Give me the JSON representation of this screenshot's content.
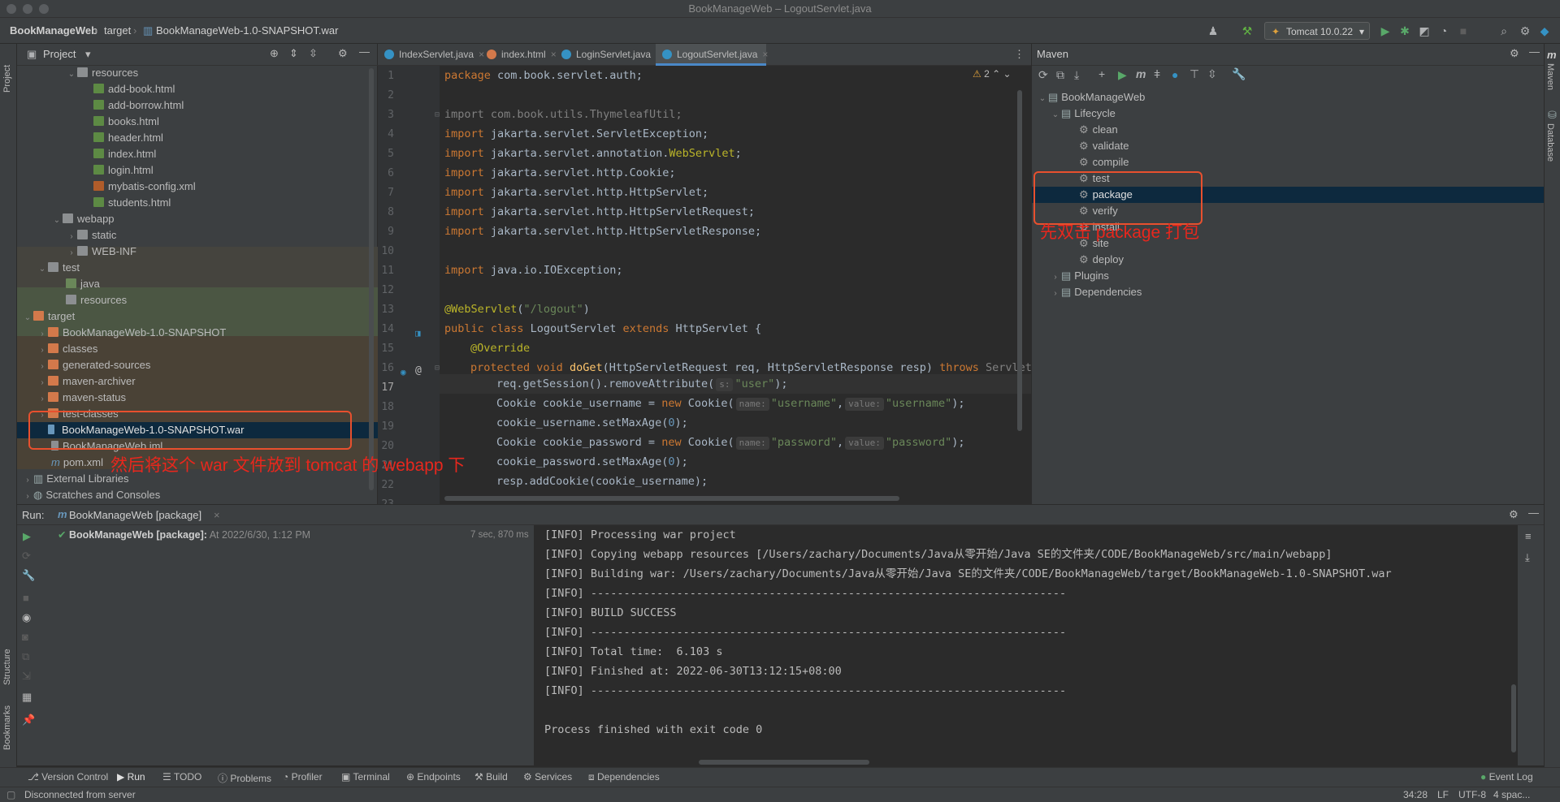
{
  "window": {
    "title": "BookManageWeb – LogoutServlet.java"
  },
  "breadcrumb": {
    "project": "BookManageWeb",
    "folder": "target",
    "file": "BookManageWeb-1.0-SNAPSHOT.war"
  },
  "run_config": {
    "label": "Tomcat 10.0.22"
  },
  "project_panel": {
    "title": "Project",
    "tree": [
      {
        "label": "resources",
        "icon": "folder",
        "expanded": true
      },
      {
        "label": "add-book.html",
        "icon": "html-file-icon"
      },
      {
        "label": "add-borrow.html",
        "icon": "html-file-icon"
      },
      {
        "label": "books.html",
        "icon": "html-file-icon"
      },
      {
        "label": "header.html",
        "icon": "html-file-icon"
      },
      {
        "label": "index.html",
        "icon": "html-file-icon"
      },
      {
        "label": "login.html",
        "icon": "html-file-icon"
      },
      {
        "label": "mybatis-config.xml",
        "icon": "xml-file-icon"
      },
      {
        "label": "students.html",
        "icon": "html-file-icon"
      },
      {
        "label": "webapp",
        "icon": "folder",
        "expanded": true
      },
      {
        "label": "static",
        "icon": "folder"
      },
      {
        "label": "WEB-INF",
        "icon": "folder"
      },
      {
        "label": "test",
        "icon": "folder",
        "expanded": true
      },
      {
        "label": "java",
        "icon": "folder-green"
      },
      {
        "label": "resources",
        "icon": "folder-resources"
      },
      {
        "label": "target",
        "icon": "folder-orange",
        "expanded": true
      },
      {
        "label": "BookManageWeb-1.0-SNAPSHOT",
        "icon": "folder-orange"
      },
      {
        "label": "classes",
        "icon": "folder-orange"
      },
      {
        "label": "generated-sources",
        "icon": "folder-orange"
      },
      {
        "label": "maven-archiver",
        "icon": "folder-orange"
      },
      {
        "label": "maven-status",
        "icon": "folder-orange"
      },
      {
        "label": "test-classes",
        "icon": "folder-orange"
      },
      {
        "label": "BookManageWeb-1.0-SNAPSHOT.war",
        "icon": "war-file-icon",
        "selected": true
      },
      {
        "label": "BookManageWeb.iml",
        "icon": "iml-file-icon"
      },
      {
        "label": "pom.xml",
        "icon": "maven-file-icon"
      },
      {
        "label": "External Libraries",
        "icon": "library-icon"
      },
      {
        "label": "Scratches and Consoles",
        "icon": "scratches-icon"
      }
    ]
  },
  "editor": {
    "tabs": [
      {
        "label": "IndexServlet.java",
        "active": false
      },
      {
        "label": "index.html",
        "active": false
      },
      {
        "label": "LoginServlet.java",
        "active": false
      },
      {
        "label": "LogoutServlet.java",
        "active": true
      }
    ],
    "warnings": "2",
    "line_numbers": [
      "1",
      "2",
      "3",
      "4",
      "5",
      "6",
      "7",
      "8",
      "9",
      "10",
      "11",
      "12",
      "13",
      "14",
      "15",
      "16",
      "17",
      "18",
      "19",
      "20",
      "21",
      "22",
      "23"
    ],
    "code": {
      "l1": [
        "package",
        " com.book.servlet.auth;"
      ],
      "l3": [
        "import com.book.utils.ThymeleafUtil;"
      ],
      "l4": [
        "import",
        " jakarta.servlet.ServletException;"
      ],
      "l5": [
        "import",
        " jakarta.servlet.annotation.",
        "WebServlet",
        ";"
      ],
      "l6": [
        "import",
        " jakarta.servlet.http.Cookie;"
      ],
      "l7": [
        "import",
        " jakarta.servlet.http.HttpServlet;"
      ],
      "l8": [
        "import",
        " jakarta.servlet.http.HttpServletRequest;"
      ],
      "l9": [
        "import",
        " jakarta.servlet.http.HttpServletResponse;"
      ],
      "l11": [
        "import",
        " java.io.IOException;"
      ],
      "l13": [
        "@WebServlet",
        "(",
        "\"/logout\"",
        ")"
      ],
      "l14": [
        "public class",
        " LogoutServlet ",
        "extends",
        " HttpServlet {"
      ],
      "l15": [
        "@Override"
      ],
      "l16": [
        "protected void",
        " ",
        "doGet",
        "(HttpServletRequest req, HttpServletResponse resp) ",
        "throws",
        " ServletE"
      ],
      "l17": [
        "req.getSession().removeAttribute(",
        "s:",
        "\"user\"",
        ");"
      ],
      "l18": [
        "Cookie cookie_username = ",
        "new",
        " Cookie(",
        "name:",
        "\"username\"",
        ",",
        "value:",
        "\"username\"",
        ");"
      ],
      "l19": [
        "cookie_username.setMaxAge(",
        "0",
        ");"
      ],
      "l20": [
        "Cookie cookie_password = ",
        "new",
        " Cookie(",
        "name:",
        "\"password\"",
        ",",
        "value:",
        "\"password\"",
        ");"
      ],
      "l21": [
        "cookie_password.setMaxAge(",
        "0",
        ");"
      ],
      "l22": [
        "resp.addCookie(cookie_username);"
      ]
    }
  },
  "maven": {
    "title": "Maven",
    "root": "BookManageWeb",
    "lifecycle_label": "Lifecycle",
    "phases": [
      "clean",
      "validate",
      "compile",
      "test",
      "package",
      "verify",
      "install",
      "site",
      "deploy"
    ],
    "selected_phase": "package",
    "plugins_label": "Plugins",
    "dependencies_label": "Dependencies"
  },
  "annotations": {
    "maven_note": "先双击 package 打包",
    "war_note": "然后将这个 war 文件放到 tomcat 的 webapp 下",
    "color": "#e8271d"
  },
  "run": {
    "label": "Run:",
    "tab": "BookManageWeb [package]",
    "task_name": "BookManageWeb [package]:",
    "task_time": " At 2022/6/30, 1:12 PM",
    "duration": "7 sec, 870 ms",
    "console": [
      "[INFO] Processing war project",
      "[INFO] Copying webapp resources [/Users/zachary/Documents/Java从零开始/Java SE的文件夹/CODE/BookManageWeb/src/main/webapp]",
      "[INFO] Building war: /Users/zachary/Documents/Java从零开始/Java SE的文件夹/CODE/BookManageWeb/target/BookManageWeb-1.0-SNAPSHOT.war",
      "[INFO] ------------------------------------------------------------------------",
      "[INFO] BUILD SUCCESS",
      "[INFO] ------------------------------------------------------------------------",
      "[INFO] Total time:  6.103 s",
      "[INFO] Finished at: 2022-06-30T13:12:15+08:00",
      "[INFO] ------------------------------------------------------------------------",
      "",
      "Process finished with exit code 0"
    ]
  },
  "tool_windows": [
    "Version Control",
    "Run",
    "TODO",
    "Problems",
    "Profiler",
    "Terminal",
    "Endpoints",
    "Build",
    "Services",
    "Dependencies"
  ],
  "event_log": "Event Log",
  "side_labels": {
    "project": "Project",
    "structure": "Structure",
    "bookmarks": "Bookmarks",
    "maven": "Maven",
    "database": "Database"
  },
  "status": {
    "message": "Disconnected from server",
    "position": "34:28",
    "line_sep": "LF",
    "encoding": "UTF-8",
    "indent": "4 spac..."
  }
}
